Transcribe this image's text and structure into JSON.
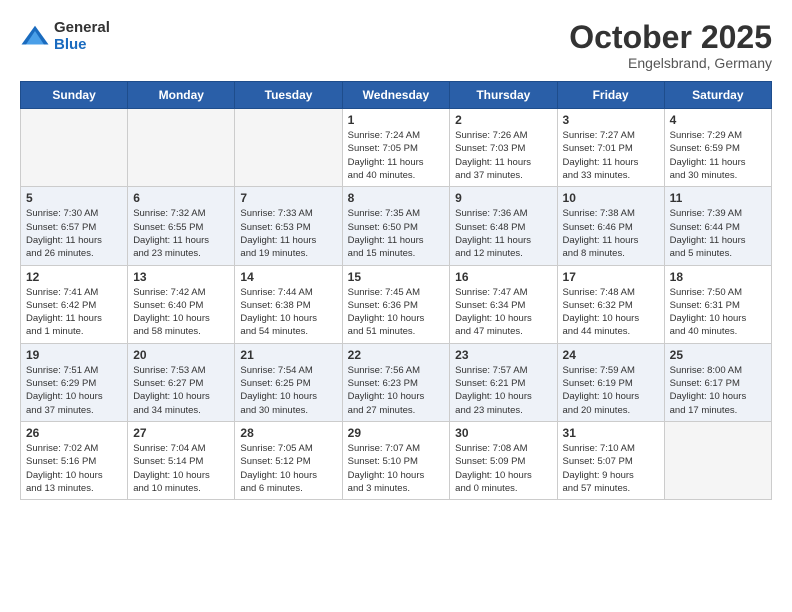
{
  "header": {
    "logo_general": "General",
    "logo_blue": "Blue",
    "month": "October 2025",
    "location": "Engelsbrand, Germany"
  },
  "days_of_week": [
    "Sunday",
    "Monday",
    "Tuesday",
    "Wednesday",
    "Thursday",
    "Friday",
    "Saturday"
  ],
  "weeks": [
    [
      {
        "day": "",
        "info": ""
      },
      {
        "day": "",
        "info": ""
      },
      {
        "day": "",
        "info": ""
      },
      {
        "day": "1",
        "info": "Sunrise: 7:24 AM\nSunset: 7:05 PM\nDaylight: 11 hours\nand 40 minutes."
      },
      {
        "day": "2",
        "info": "Sunrise: 7:26 AM\nSunset: 7:03 PM\nDaylight: 11 hours\nand 37 minutes."
      },
      {
        "day": "3",
        "info": "Sunrise: 7:27 AM\nSunset: 7:01 PM\nDaylight: 11 hours\nand 33 minutes."
      },
      {
        "day": "4",
        "info": "Sunrise: 7:29 AM\nSunset: 6:59 PM\nDaylight: 11 hours\nand 30 minutes."
      }
    ],
    [
      {
        "day": "5",
        "info": "Sunrise: 7:30 AM\nSunset: 6:57 PM\nDaylight: 11 hours\nand 26 minutes."
      },
      {
        "day": "6",
        "info": "Sunrise: 7:32 AM\nSunset: 6:55 PM\nDaylight: 11 hours\nand 23 minutes."
      },
      {
        "day": "7",
        "info": "Sunrise: 7:33 AM\nSunset: 6:53 PM\nDaylight: 11 hours\nand 19 minutes."
      },
      {
        "day": "8",
        "info": "Sunrise: 7:35 AM\nSunset: 6:50 PM\nDaylight: 11 hours\nand 15 minutes."
      },
      {
        "day": "9",
        "info": "Sunrise: 7:36 AM\nSunset: 6:48 PM\nDaylight: 11 hours\nand 12 minutes."
      },
      {
        "day": "10",
        "info": "Sunrise: 7:38 AM\nSunset: 6:46 PM\nDaylight: 11 hours\nand 8 minutes."
      },
      {
        "day": "11",
        "info": "Sunrise: 7:39 AM\nSunset: 6:44 PM\nDaylight: 11 hours\nand 5 minutes."
      }
    ],
    [
      {
        "day": "12",
        "info": "Sunrise: 7:41 AM\nSunset: 6:42 PM\nDaylight: 11 hours\nand 1 minute."
      },
      {
        "day": "13",
        "info": "Sunrise: 7:42 AM\nSunset: 6:40 PM\nDaylight: 10 hours\nand 58 minutes."
      },
      {
        "day": "14",
        "info": "Sunrise: 7:44 AM\nSunset: 6:38 PM\nDaylight: 10 hours\nand 54 minutes."
      },
      {
        "day": "15",
        "info": "Sunrise: 7:45 AM\nSunset: 6:36 PM\nDaylight: 10 hours\nand 51 minutes."
      },
      {
        "day": "16",
        "info": "Sunrise: 7:47 AM\nSunset: 6:34 PM\nDaylight: 10 hours\nand 47 minutes."
      },
      {
        "day": "17",
        "info": "Sunrise: 7:48 AM\nSunset: 6:32 PM\nDaylight: 10 hours\nand 44 minutes."
      },
      {
        "day": "18",
        "info": "Sunrise: 7:50 AM\nSunset: 6:31 PM\nDaylight: 10 hours\nand 40 minutes."
      }
    ],
    [
      {
        "day": "19",
        "info": "Sunrise: 7:51 AM\nSunset: 6:29 PM\nDaylight: 10 hours\nand 37 minutes."
      },
      {
        "day": "20",
        "info": "Sunrise: 7:53 AM\nSunset: 6:27 PM\nDaylight: 10 hours\nand 34 minutes."
      },
      {
        "day": "21",
        "info": "Sunrise: 7:54 AM\nSunset: 6:25 PM\nDaylight: 10 hours\nand 30 minutes."
      },
      {
        "day": "22",
        "info": "Sunrise: 7:56 AM\nSunset: 6:23 PM\nDaylight: 10 hours\nand 27 minutes."
      },
      {
        "day": "23",
        "info": "Sunrise: 7:57 AM\nSunset: 6:21 PM\nDaylight: 10 hours\nand 23 minutes."
      },
      {
        "day": "24",
        "info": "Sunrise: 7:59 AM\nSunset: 6:19 PM\nDaylight: 10 hours\nand 20 minutes."
      },
      {
        "day": "25",
        "info": "Sunrise: 8:00 AM\nSunset: 6:17 PM\nDaylight: 10 hours\nand 17 minutes."
      }
    ],
    [
      {
        "day": "26",
        "info": "Sunrise: 7:02 AM\nSunset: 5:16 PM\nDaylight: 10 hours\nand 13 minutes."
      },
      {
        "day": "27",
        "info": "Sunrise: 7:04 AM\nSunset: 5:14 PM\nDaylight: 10 hours\nand 10 minutes."
      },
      {
        "day": "28",
        "info": "Sunrise: 7:05 AM\nSunset: 5:12 PM\nDaylight: 10 hours\nand 6 minutes."
      },
      {
        "day": "29",
        "info": "Sunrise: 7:07 AM\nSunset: 5:10 PM\nDaylight: 10 hours\nand 3 minutes."
      },
      {
        "day": "30",
        "info": "Sunrise: 7:08 AM\nSunset: 5:09 PM\nDaylight: 10 hours\nand 0 minutes."
      },
      {
        "day": "31",
        "info": "Sunrise: 7:10 AM\nSunset: 5:07 PM\nDaylight: 9 hours\nand 57 minutes."
      },
      {
        "day": "",
        "info": ""
      }
    ]
  ]
}
